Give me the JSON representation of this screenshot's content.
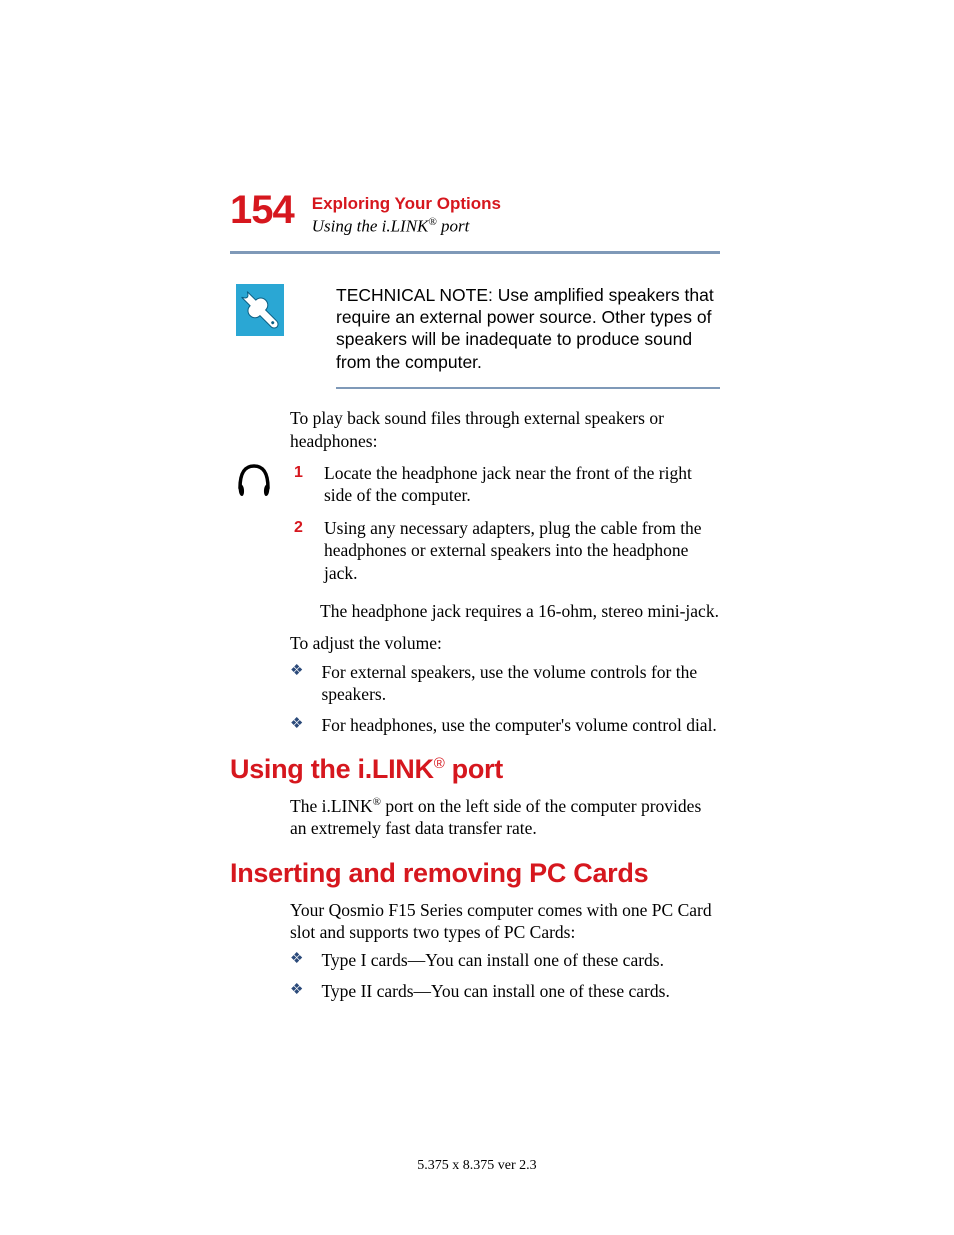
{
  "header": {
    "page_number": "154",
    "chapter": "Exploring Your Options",
    "section_prefix": "Using the i.LINK",
    "section_reg": "®",
    "section_suffix": " port"
  },
  "technote": {
    "label": "TECHNICAL NOTE:",
    "text": " Use amplified speakers that require an external power source. Other types of speakers will be inadequate to produce sound from the computer."
  },
  "intro1": "To play back sound files through external speakers or headphones:",
  "steps": [
    {
      "n": "1",
      "t": "Locate the headphone jack near the front of the right side of the computer."
    },
    {
      "n": "2",
      "t": "Using any necessary adapters, plug the cable from the headphones or external speakers into the headphone jack."
    }
  ],
  "after_steps": "The headphone jack requires a 16-ohm, stereo mini-jack.",
  "intro2": "To adjust the volume:",
  "bullets1": [
    "For external speakers, use the volume controls for the speakers.",
    "For headphones, use the computer's volume control dial."
  ],
  "h2a_prefix": "Using the i.LINK",
  "h2a_reg": "®",
  "h2a_suffix": " port",
  "para_a_prefix": "The i.LINK",
  "para_a_reg": "®",
  "para_a_suffix": " port on the left side of the computer provides an extremely fast data transfer rate.",
  "h2b": "Inserting and removing PC Cards",
  "para_b": "Your Qosmio F15 Series computer comes with one PC Card slot and supports two types of PC Cards:",
  "bullets2": [
    "Type I cards—You can install one of these cards.",
    "Type II cards—You can install one of these cards."
  ],
  "footer": "5.375 x 8.375 ver 2.3"
}
